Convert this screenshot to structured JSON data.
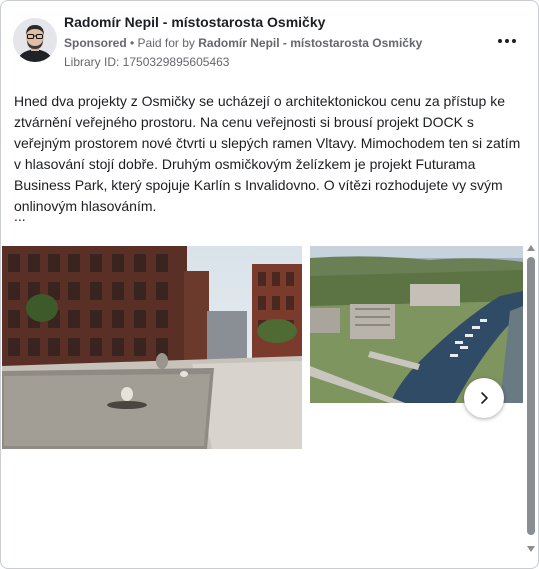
{
  "post": {
    "page_name": "Radomír Nepil - místostarosta Osmičky",
    "sponsored_label": "Sponsored",
    "separator": " • ",
    "paid_for_prefix": "Paid for by ",
    "paid_for_name": "Radomír Nepil - místostarosta Osmičky",
    "library_id": "Library ID: 1750329895605463",
    "text": "Hned dva projekty z Osmičky se ucházejí o architektonickou cenu za přístup ke ztvárnění veřejného prostoru. Na cenu veřejnosti si brousí projekt DOCK s veřejným prostorem nové čtvrti u slepých ramen Vltavy. Mimochodem ten si zatím v hlasování stojí dobře. Druhým osmičkovým želízkem je projekt Futurama Business Park, který spojuje Karlín s Invalidovno. O vítězi rozhodujete vy svým onlinovým hlasováním.",
    "ellipsis": "..."
  },
  "icons": {
    "more": "more-horizontal-icon",
    "next": "chevron-right-icon"
  },
  "colors": {
    "text_primary": "#1c1e21",
    "text_secondary": "#65676b",
    "border": "#c9ccd1",
    "scrollbar": "#8a8d91"
  }
}
